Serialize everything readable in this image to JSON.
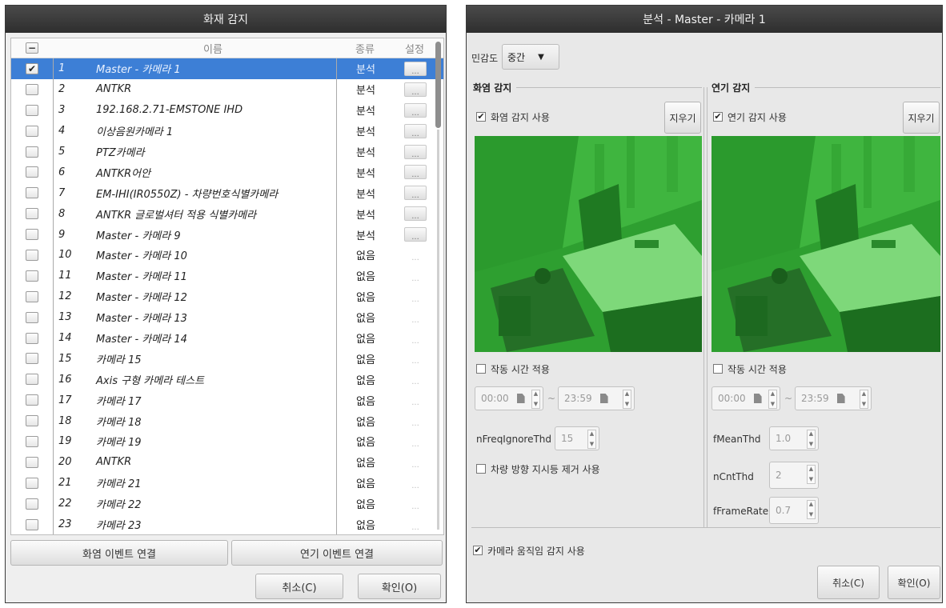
{
  "left_window": {
    "title": "화재 감지",
    "headers": {
      "name": "이름",
      "type": "종류",
      "settings": "설정"
    },
    "rows": [
      {
        "num": "1",
        "name": "Master - 카메라 1",
        "type": "분석",
        "checked": true,
        "selected": true,
        "settings": "..."
      },
      {
        "num": "2",
        "name": "ANTKR",
        "type": "분석",
        "checked": false,
        "selected": false,
        "settings": "..."
      },
      {
        "num": "3",
        "name": "192.168.2.71-EMSTONE IHD",
        "type": "분석",
        "checked": false,
        "selected": false,
        "settings": "..."
      },
      {
        "num": "4",
        "name": "이상음원카메라 1",
        "type": "분석",
        "checked": false,
        "selected": false,
        "settings": "..."
      },
      {
        "num": "5",
        "name": "PTZ카메라",
        "type": "분석",
        "checked": false,
        "selected": false,
        "settings": "..."
      },
      {
        "num": "6",
        "name": "ANTKR어안",
        "type": "분석",
        "checked": false,
        "selected": false,
        "settings": "..."
      },
      {
        "num": "7",
        "name": "EM-IHI(IR0550Z) - 차량번호식별카메라",
        "type": "분석",
        "checked": false,
        "selected": false,
        "settings": "..."
      },
      {
        "num": "8",
        "name": "ANTKR 글로벌셔터 적용 식별카메라",
        "type": "분석",
        "checked": false,
        "selected": false,
        "settings": "..."
      },
      {
        "num": "9",
        "name": "Master - 카메라 9",
        "type": "분석",
        "checked": false,
        "selected": false,
        "settings": "..."
      },
      {
        "num": "10",
        "name": "Master - 카메라 10",
        "type": "없음",
        "checked": false,
        "selected": false,
        "settings": "..."
      },
      {
        "num": "11",
        "name": "Master - 카메라 11",
        "type": "없음",
        "checked": false,
        "selected": false,
        "settings": "..."
      },
      {
        "num": "12",
        "name": "Master - 카메라 12",
        "type": "없음",
        "checked": false,
        "selected": false,
        "settings": "..."
      },
      {
        "num": "13",
        "name": "Master - 카메라 13",
        "type": "없음",
        "checked": false,
        "selected": false,
        "settings": "..."
      },
      {
        "num": "14",
        "name": "Master - 카메라 14",
        "type": "없음",
        "checked": false,
        "selected": false,
        "settings": "..."
      },
      {
        "num": "15",
        "name": "카메라 15",
        "type": "없음",
        "checked": false,
        "selected": false,
        "settings": "..."
      },
      {
        "num": "16",
        "name": "Axis 구형 카메라 테스트",
        "type": "없음",
        "checked": false,
        "selected": false,
        "settings": "..."
      },
      {
        "num": "17",
        "name": "카메라 17",
        "type": "없음",
        "checked": false,
        "selected": false,
        "settings": "..."
      },
      {
        "num": "18",
        "name": "카메라 18",
        "type": "없음",
        "checked": false,
        "selected": false,
        "settings": "..."
      },
      {
        "num": "19",
        "name": "카메라 19",
        "type": "없음",
        "checked": false,
        "selected": false,
        "settings": "..."
      },
      {
        "num": "20",
        "name": "ANTKR",
        "type": "없음",
        "checked": false,
        "selected": false,
        "settings": "..."
      },
      {
        "num": "21",
        "name": "카메라 21",
        "type": "없음",
        "checked": false,
        "selected": false,
        "settings": "..."
      },
      {
        "num": "22",
        "name": "카메라 22",
        "type": "없음",
        "checked": false,
        "selected": false,
        "settings": "..."
      },
      {
        "num": "23",
        "name": "카메라 23",
        "type": "없음",
        "checked": false,
        "selected": false,
        "settings": "..."
      }
    ],
    "buttons": {
      "fire_event_link": "화염 이벤트 연결",
      "smoke_event_link": "연기 이벤트 연결",
      "cancel": "취소(C)",
      "ok": "확인(O)"
    }
  },
  "right_window": {
    "title": "분석 - Master - 카메라 1",
    "sensitivity": {
      "label": "민감도",
      "value": "중간"
    },
    "fire": {
      "section_title": "화염 감지",
      "enable_label": "화염 감지 사용",
      "enable_checked": true,
      "clear_button": "지우기",
      "schedule_label": "작동 시간 적용",
      "schedule_checked": false,
      "start_time": "00:00",
      "end_time": "23:59",
      "time_separator": "~",
      "freq_label": "nFreqIgnoreThd",
      "freq_value": "15",
      "turn_signal_label": "차량 방향 지시등 제거 사용",
      "turn_signal_checked": false
    },
    "smoke": {
      "section_title": "연기 감지",
      "enable_label": "연기 감지 사용",
      "enable_checked": true,
      "clear_button": "지우기",
      "schedule_label": "작동 시간 적용",
      "schedule_checked": false,
      "start_time": "00:00",
      "end_time": "23:59",
      "time_separator": "~",
      "mean_label": "fMeanThd",
      "mean_value": "1.0",
      "cnt_label": "nCntThd",
      "cnt_value": "2",
      "framerate_label": "fFrameRate",
      "framerate_value": "0.7"
    },
    "camera_motion_label": "카메라 움직임 감지 사용",
    "camera_motion_checked": true,
    "buttons": {
      "cancel": "취소(C)",
      "ok": "확인(O)"
    }
  }
}
